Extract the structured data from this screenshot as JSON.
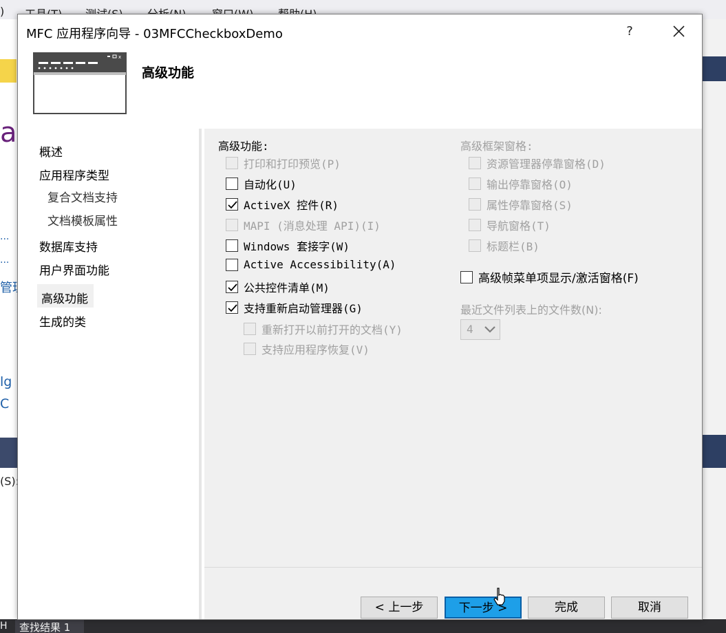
{
  "background": {
    "menu": [
      ")",
      "工具(T)",
      "测试(S)",
      "分析(N)",
      "窗口(W)",
      "帮助(H)"
    ],
    "left_fragments": [
      "al",
      "...",
      "...",
      "管理",
      "lg",
      "C",
      "(S):",
      "H"
    ],
    "find_tab": "查找结果 1"
  },
  "dialog": {
    "title": "MFC 应用程序向导 - 03MFCCheckboxDemo",
    "help_label": "?",
    "heading": "高级功能",
    "nav": [
      "概述",
      "应用程序类型",
      "复合文档支持",
      "文档模板属性",
      "数据库支持",
      "用户界面功能",
      "高级功能",
      "生成的类"
    ],
    "left_group": {
      "label": "高级功能:",
      "options": [
        {
          "label": "打印和打印预览(P)",
          "checked": false,
          "disabled": true
        },
        {
          "label": "自动化(U)",
          "checked": false,
          "disabled": false
        },
        {
          "label": "ActiveX 控件(R)",
          "checked": true,
          "disabled": false
        },
        {
          "label": "MAPI (消息处理 API)(I)",
          "checked": false,
          "disabled": true
        },
        {
          "label": "Windows 套接字(W)",
          "checked": false,
          "disabled": false
        },
        {
          "label": "Active Accessibility(A)",
          "checked": false,
          "disabled": false
        },
        {
          "label": "公共控件清单(M)",
          "checked": true,
          "disabled": false
        },
        {
          "label": "支持重新启动管理器(G)",
          "checked": true,
          "disabled": false
        },
        {
          "label": "重新打开以前打开的文档(Y)",
          "checked": false,
          "disabled": true
        },
        {
          "label": "支持应用程序恢复(V)",
          "checked": false,
          "disabled": true
        }
      ]
    },
    "right_group": {
      "label": "高级框架窗格:",
      "options": [
        {
          "label": "资源管理器停靠窗格(D)",
          "checked": false,
          "disabled": true
        },
        {
          "label": "输出停靠窗格(O)",
          "checked": false,
          "disabled": true
        },
        {
          "label": "属性停靠窗格(S)",
          "checked": false,
          "disabled": true
        },
        {
          "label": "导航窗格(T)",
          "checked": false,
          "disabled": true
        },
        {
          "label": "标题栏(B)",
          "checked": false,
          "disabled": true
        }
      ]
    },
    "mdi_menu_option": {
      "label": "高级帧菜单项显示/激活窗格(F)",
      "checked": false,
      "disabled": false
    },
    "mru": {
      "label": "最近文件列表上的文件数(N):",
      "value": "4"
    },
    "buttons": {
      "prev": "< 上一步",
      "next": "下一步 >",
      "finish": "完成",
      "cancel": "取消"
    }
  }
}
